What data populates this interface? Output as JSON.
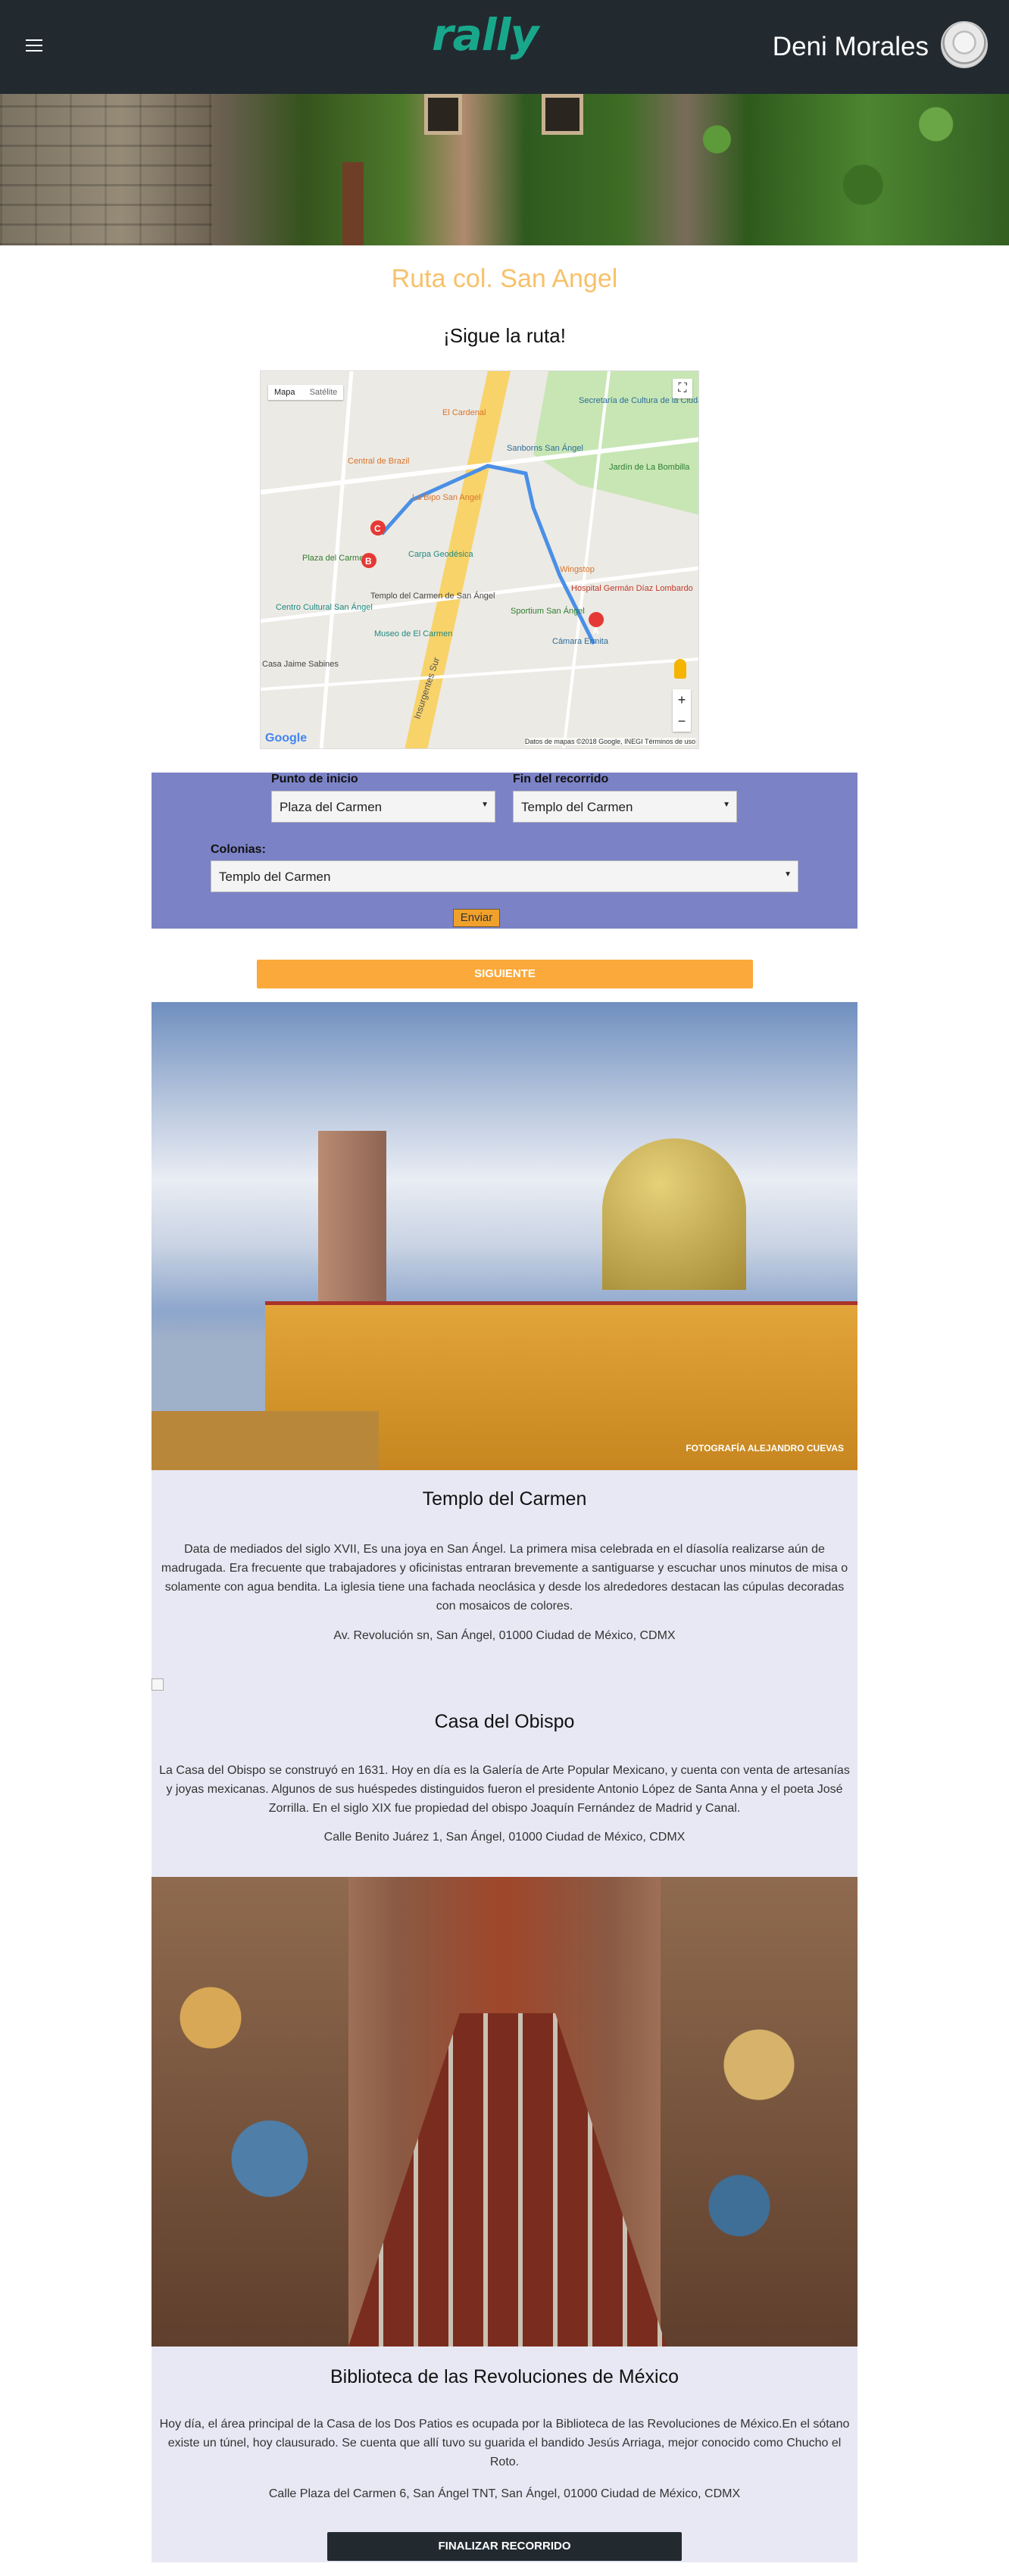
{
  "header": {
    "logo": "rally",
    "user_name": "Deni Morales"
  },
  "route": {
    "title": "Ruta col. San Angel",
    "subtitle": "¡Sigue la ruta!"
  },
  "map": {
    "toggle_map": "Mapa",
    "toggle_satellite": "Satélite",
    "google_label": "Google",
    "credit": "Datos de mapas ©2018 Google, INEGI    Términos de uso",
    "labels": [
      "Secretaría de Cultura de la Ciudad de México",
      "Sanborns San Ángel",
      "Jardín de La Bombilla",
      "El Cardenal",
      "Central de Brazil",
      "La Bipo San Angel",
      "Carpa Geodésica",
      "Wingstop",
      "Hospital Germán Díaz Lombardo",
      "Sportium San Ángel",
      "Templo del Carmen de San Ángel",
      "Museo de El Carmen",
      "Centro Cultural San Ángel",
      "Plaza del Carmen",
      "Casa Jaime Sabines",
      "Cámara Ermita",
      "Insurgentes Sur"
    ],
    "markers": [
      "A",
      "B",
      "C"
    ]
  },
  "form": {
    "start_label": "Punto de inicio",
    "start_value": "Plaza del Carmen",
    "end_label": "Fin del recorrido",
    "end_value": "Templo del Carmen",
    "colonias_label": "Colonias:",
    "colonias_value": "Templo del Carmen",
    "send_label": "Enviar"
  },
  "next_label": "SIGUIENTE",
  "places": [
    {
      "title": "Templo del Carmen",
      "description": "Data de mediados del siglo XVII, Es una joya en San Ángel. La primera misa celebrada en el díasolía realizarse aún de madrugada. Era frecuente que trabajadores y oficinistas entraran brevemente a santiguarse y escuchar unos minutos de misa o solamente con agua bendita. La iglesia tiene una fachada neoclásica y desde los alrededores destacan las cúpulas decoradas con mosaicos de colores.",
      "address": "Av. Revolución sn, San Ángel, 01000 Ciudad de México, CDMX",
      "photo_credit": "FOTOGRAFÍA ALEJANDRO CUEVAS"
    },
    {
      "title": "Casa del Obispo",
      "description": "La Casa del Obispo se construyó en 1631. Hoy en día es la Galería de Arte Popular Mexicano, y cuenta con venta de artesanías y joyas mexicanas. Algunos de sus huéspedes distinguidos fueron el presidente Antonio López de Santa Anna y el poeta José Zorrilla. En el siglo XIX fue propiedad del obispo Joaquín Fernández de Madrid y Canal.",
      "address": "Calle Benito Juárez 1, San Ángel, 01000 Ciudad de México, CDMX"
    },
    {
      "title": "Biblioteca de las Revoluciones de México",
      "description": "Hoy día, el área principal de la Casa de los Dos Patios es ocupada por la Biblioteca de las Revoluciones de México.En el sótano existe un túnel, hoy clausurado. Se cuenta que allí tuvo su guarida el bandido Jesús Arriaga, mejor conocido como Chucho el Roto.",
      "address": "Calle Plaza del Carmen 6, San Ángel TNT, San Ángel, 01000 Ciudad de México, CDMX"
    }
  ],
  "finish_label": "FINALIZAR RECORRIDO"
}
